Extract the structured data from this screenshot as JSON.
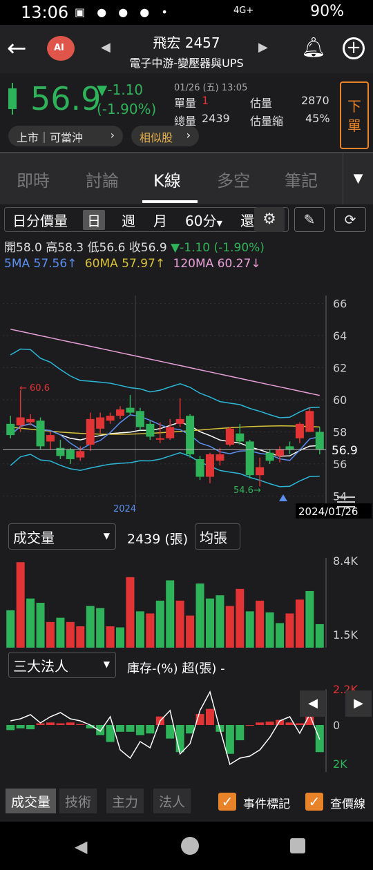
{
  "status": {
    "time": "13:06",
    "icons": "▣ ● ● ● •",
    "network": "4G+",
    "battery": "90%"
  },
  "header": {
    "title": "飛宏 2457",
    "subtitle": "電子中游-變壓器與UPS",
    "prev": "◀",
    "next": "▶"
  },
  "quote": {
    "price": "56.9",
    "change": "▼-1.10",
    "change_pct": "(-1.90%)",
    "timestamp": "01/26 (五) 13:05",
    "unit_vol_label": "單量",
    "unit_vol": "1",
    "est_vol_label": "估量",
    "est_vol": "2870",
    "total_vol_label": "總量",
    "total_vol": "2439",
    "est_shrink_label": "估量縮",
    "est_shrink": "45%",
    "sell_label": "下單",
    "market_tag": "上市｜可當沖",
    "similar_tag": "相似股"
  },
  "tabs": [
    "即時",
    "討論",
    "K線",
    "多空",
    "筆記"
  ],
  "periods": {
    "items": [
      "日分價量",
      "日",
      "週",
      "月",
      "60分",
      "還"
    ],
    "selected": "日"
  },
  "ohlc": {
    "open": "開58.0",
    "high": "高58.3",
    "low": "低56.6",
    "close": "收56.9",
    "chg": "▼-1.10 (-1.90%)"
  },
  "ma": {
    "ma5": "5MA 57.56↑",
    "ma60": "60MA 57.97↑",
    "ma120": "120MA 60.27↓"
  },
  "colors": {
    "up": "#e23434",
    "down": "#2fb35a",
    "ma5": "#5b8ff0",
    "ma60": "#d8c23a",
    "ma120": "#e8a0d8",
    "bb": "#2ab8d8",
    "mid": "#ffffff"
  },
  "chart_data": {
    "type": "candlestick",
    "ylim": [
      53.5,
      66.5
    ],
    "yticks": [
      54,
      56,
      58,
      60,
      62,
      64,
      66
    ],
    "current_price_label": "56.9",
    "year_label": "2024",
    "date_label": "2024/01/26",
    "annotation_high": "60.6",
    "annotation_low": "54.6",
    "candles": [
      {
        "o": 58.5,
        "c": 57.8,
        "h": 59.0,
        "l": 57.6
      },
      {
        "o": 58.4,
        "c": 58.9,
        "h": 60.6,
        "l": 58.0
      },
      {
        "o": 58.6,
        "c": 58.8,
        "h": 59.1,
        "l": 58.4
      },
      {
        "o": 58.7,
        "c": 57.1,
        "h": 58.9,
        "l": 56.9
      },
      {
        "o": 57.4,
        "c": 57.8,
        "h": 58.0,
        "l": 56.9
      },
      {
        "o": 57.0,
        "c": 56.5,
        "h": 57.5,
        "l": 56.3
      },
      {
        "o": 56.9,
        "c": 56.3,
        "h": 57.0,
        "l": 56.0
      },
      {
        "o": 56.4,
        "c": 56.8,
        "h": 57.1,
        "l": 56.2
      },
      {
        "o": 57.2,
        "c": 58.8,
        "h": 59.2,
        "l": 56.8
      },
      {
        "o": 58.2,
        "c": 58.9,
        "h": 59.2,
        "l": 57.9
      },
      {
        "o": 58.7,
        "c": 59.0,
        "h": 59.2,
        "l": 58.5
      },
      {
        "o": 59.0,
        "c": 59.4,
        "h": 59.6,
        "l": 58.8
      },
      {
        "o": 59.5,
        "c": 59.2,
        "h": 60.3,
        "l": 59.0
      },
      {
        "o": 59.3,
        "c": 58.3,
        "h": 59.5,
        "l": 58.1
      },
      {
        "o": 58.5,
        "c": 57.7,
        "h": 58.7,
        "l": 57.5
      },
      {
        "o": 57.6,
        "c": 57.6,
        "h": 58.6,
        "l": 57.3
      },
      {
        "o": 57.6,
        "c": 58.3,
        "h": 58.8,
        "l": 57.5
      },
      {
        "o": 58.5,
        "c": 58.8,
        "h": 60.1,
        "l": 58.3
      },
      {
        "o": 59.0,
        "c": 56.6,
        "h": 59.1,
        "l": 56.4
      },
      {
        "o": 56.3,
        "c": 55.2,
        "h": 56.5,
        "l": 55.0
      },
      {
        "o": 55.2,
        "c": 56.6,
        "h": 56.7,
        "l": 54.8
      },
      {
        "o": 56.2,
        "c": 56.6,
        "h": 57.0,
        "l": 55.9
      },
      {
        "o": 57.2,
        "c": 58.2,
        "h": 58.3,
        "l": 57.1
      },
      {
        "o": 57.9,
        "c": 57.4,
        "h": 58.5,
        "l": 57.2
      },
      {
        "o": 57.4,
        "c": 55.3,
        "h": 57.5,
        "l": 55.1
      },
      {
        "o": 55.3,
        "c": 55.8,
        "h": 56.4,
        "l": 54.6
      },
      {
        "o": 56.7,
        "c": 56.2,
        "h": 56.9,
        "l": 56.0
      },
      {
        "o": 56.5,
        "c": 56.9,
        "h": 57.1,
        "l": 56.1
      },
      {
        "o": 57.1,
        "c": 56.9,
        "h": 57.4,
        "l": 56.6
      },
      {
        "o": 57.6,
        "c": 58.5,
        "h": 58.6,
        "l": 57.3
      },
      {
        "o": 58.0,
        "c": 59.3,
        "h": 59.5,
        "l": 58.0
      },
      {
        "o": 58.0,
        "c": 56.9,
        "h": 58.3,
        "l": 56.6
      }
    ],
    "volume": {
      "label": "成交量",
      "value": "2439 (張)",
      "mode": "均張",
      "ylim": [
        0,
        8400
      ],
      "yticks": [
        "8.4K",
        "1.5K"
      ],
      "bars": [
        3500,
        8000,
        4600,
        4200,
        2400,
        2800,
        2400,
        2000,
        3900,
        3700,
        2000,
        1900,
        6600,
        3400,
        3200,
        4400,
        6300,
        4400,
        3000,
        6000,
        4600,
        4900,
        3900,
        5500,
        3400,
        4400,
        3300,
        2300,
        3200,
        4500,
        5300,
        2200
      ],
      "up": [
        false,
        true,
        false,
        false,
        true,
        false,
        true,
        true,
        false,
        false,
        true,
        false,
        true,
        false,
        true,
        false,
        false,
        true,
        true,
        false,
        false,
        false,
        true,
        true,
        false,
        true,
        false,
        false,
        true,
        true,
        false,
        false
      ]
    },
    "institutional": {
      "label": "三大法人",
      "caption": "庫存-(%) 超(張) -",
      "yticks": [
        "2.2K",
        "0",
        "2K"
      ],
      "bars": [
        -300,
        -200,
        -250,
        100,
        150,
        100,
        150,
        50,
        -200,
        -600,
        -1000,
        -400,
        -400,
        -600,
        -500,
        500,
        -800,
        -1600,
        -500,
        650,
        950,
        -400,
        -1700,
        -900,
        0,
        150,
        200,
        300,
        150,
        100,
        700,
        -1600
      ],
      "line": [
        0.2,
        0.3,
        0.5,
        0.1,
        0.4,
        0.6,
        0.3,
        0.2,
        0.0,
        -0.3,
        0.4,
        -1.2,
        -1.6,
        -0.8,
        -1.1,
        0.2,
        0.7,
        -1.4,
        -0.9,
        0.7,
        1.6,
        -0.2,
        -1.9,
        -1.6,
        -1.5,
        -1.2,
        -0.6,
        0.2,
        0.4,
        -0.4,
        0.5,
        -0.7
      ]
    }
  },
  "lower_tabs": [
    "成交量",
    "技術",
    "主力",
    "法人"
  ],
  "checks": {
    "event": "事件標記",
    "price": "查價線"
  }
}
